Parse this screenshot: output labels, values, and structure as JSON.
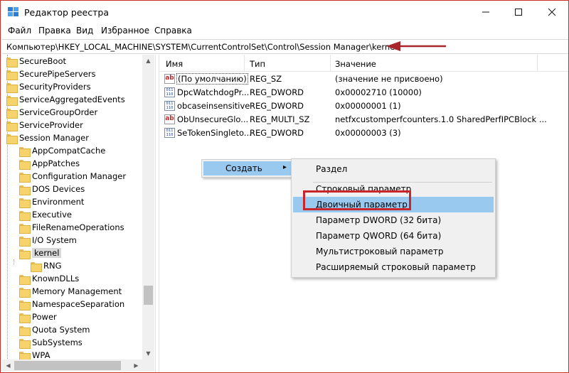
{
  "window": {
    "title": "Редактор реестра",
    "controls": {
      "minimize": "—",
      "maximize": "☐",
      "close": "✕"
    }
  },
  "menu": [
    "Файл",
    "Правка",
    "Вид",
    "Избранное",
    "Справка"
  ],
  "address": "Компьютер\\HKEY_LOCAL_MACHINE\\SYSTEM\\CurrentControlSet\\Control\\Session Manager\\kernel",
  "tree": {
    "items": [
      {
        "label": "SecureBoot",
        "level": 0
      },
      {
        "label": "SecurePipeServers",
        "level": 0
      },
      {
        "label": "SecurityProviders",
        "level": 0
      },
      {
        "label": "ServiceAggregatedEvents",
        "level": 0
      },
      {
        "label": "ServiceGroupOrder",
        "level": 0
      },
      {
        "label": "ServiceProvider",
        "level": 0
      },
      {
        "label": "Session Manager",
        "level": 0
      },
      {
        "label": "AppCompatCache",
        "level": 1
      },
      {
        "label": "AppPatches",
        "level": 1
      },
      {
        "label": "Configuration Manager",
        "level": 1
      },
      {
        "label": "DOS Devices",
        "level": 1
      },
      {
        "label": "Environment",
        "level": 1
      },
      {
        "label": "Executive",
        "level": 1
      },
      {
        "label": "FileRenameOperations",
        "level": 1
      },
      {
        "label": "I/O System",
        "level": 1
      },
      {
        "label": "kernel",
        "level": 1,
        "selected": true
      },
      {
        "label": "RNG",
        "level": 2
      },
      {
        "label": "KnownDLLs",
        "level": 1
      },
      {
        "label": "Memory Management",
        "level": 1
      },
      {
        "label": "NamespaceSeparation",
        "level": 1
      },
      {
        "label": "Power",
        "level": 1
      },
      {
        "label": "Quota System",
        "level": 1
      },
      {
        "label": "SubSystems",
        "level": 1
      },
      {
        "label": "WPA",
        "level": 1
      }
    ]
  },
  "values": {
    "headers": {
      "name": "Имя",
      "type": "Тип",
      "data": "Значение"
    },
    "rows": [
      {
        "icon": "string-value-icon",
        "name": "(По умолчанию)",
        "type": "REG_SZ",
        "data": "(значение не присвоено)"
      },
      {
        "icon": "binary-value-icon",
        "name": "DpcWatchdogPr...",
        "type": "REG_DWORD",
        "data": "0x00002710 (10000)"
      },
      {
        "icon": "binary-value-icon",
        "name": "obcaseinsensitive",
        "type": "REG_DWORD",
        "data": "0x00000001 (1)"
      },
      {
        "icon": "string-value-icon",
        "name": "ObUnsecureGlo...",
        "type": "REG_MULTI_SZ",
        "data": "netfxcustomperfcounters.1.0 SharedPerfIPCBlock ..."
      },
      {
        "icon": "binary-value-icon",
        "name": "SeTokenSingleto...",
        "type": "REG_DWORD",
        "data": "0x00000003 (3)"
      }
    ]
  },
  "context_menu": {
    "create_label": "Создать",
    "submenu": [
      "Раздел",
      "Строковый параметр",
      "Двоичный параметр",
      "Параметр DWORD (32 бита)",
      "Параметр QWORD (64 бита)",
      "Мультистроковый параметр",
      "Расширяемый строковый параметр"
    ],
    "highlighted_index": 2
  },
  "colors": {
    "selection": "#99c9ef",
    "annotation_red": "#c8262b",
    "folder": "#f6d36b"
  }
}
